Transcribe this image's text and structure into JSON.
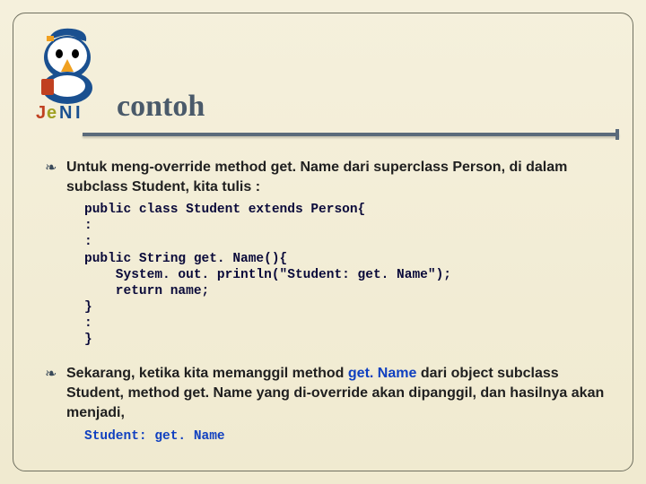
{
  "title": "contoh",
  "bullets": [
    {
      "text": "Untuk meng-override method get. Name dari superclass Person, di dalam subclass Student, kita tulis :"
    },
    {
      "text_prefix": "Sekarang, ketika kita memanggil method ",
      "text_highlight": "get. Name ",
      "text_suffix": "dari object subclass Student, method get. Name yang di-override akan dipanggil, dan hasilnya akan menjadi,"
    }
  ],
  "code": "public class Student extends Person{\n:\n:\npublic String get. Name(){\n    System. out. println(\"Student: get. Name\");\n    return name;\n}\n:\n}",
  "output": "Student: get. Name",
  "bullet_glyph": "❧"
}
